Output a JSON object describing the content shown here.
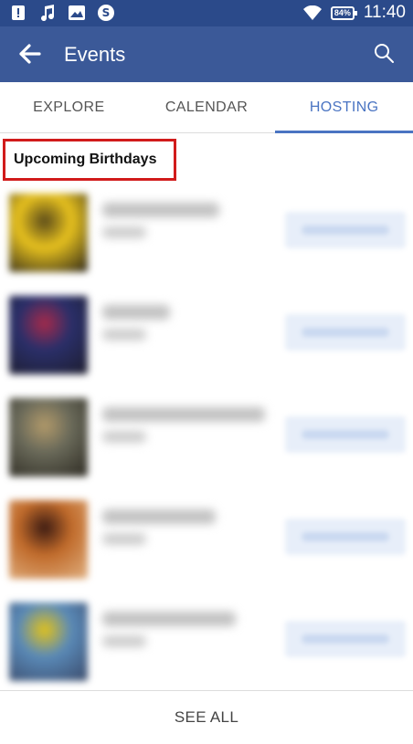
{
  "status_bar": {
    "time": "11:40",
    "battery": "84%",
    "icons": [
      "alert-icon",
      "music-icon",
      "image-icon",
      "data-saver-icon",
      "wifi-icon",
      "battery-icon"
    ]
  },
  "app_bar": {
    "title": "Events",
    "icons": [
      "back-arrow-icon",
      "search-icon"
    ]
  },
  "tabs": [
    {
      "label": "EXPLORE",
      "active": false
    },
    {
      "label": "CALENDAR",
      "active": false
    },
    {
      "label": "HOSTING",
      "active": true
    }
  ],
  "section": {
    "title": "Upcoming Birthdays"
  },
  "birthdays": [
    {
      "thumb_colors": [
        "#e8c21e",
        "#5a4a1a",
        "#2a2418"
      ]
    },
    {
      "thumb_colors": [
        "#2a2f6a",
        "#a62a4a",
        "#1d1d2d"
      ]
    },
    {
      "thumb_colors": [
        "#6a6a5a",
        "#b29a6a",
        "#2d2a22"
      ]
    },
    {
      "thumb_colors": [
        "#c06a2a",
        "#3a1a12",
        "#e0b080"
      ]
    },
    {
      "thumb_colors": [
        "#5a8ab8",
        "#e2c21a",
        "#3a4a6a"
      ]
    }
  ],
  "footer": {
    "see_all_label": "SEE ALL"
  },
  "colors": {
    "status_bar": "#2b4a8a",
    "app_bar": "#3b5998",
    "active_tab": "#4a74c2",
    "highlight_border": "#d11b1b"
  }
}
